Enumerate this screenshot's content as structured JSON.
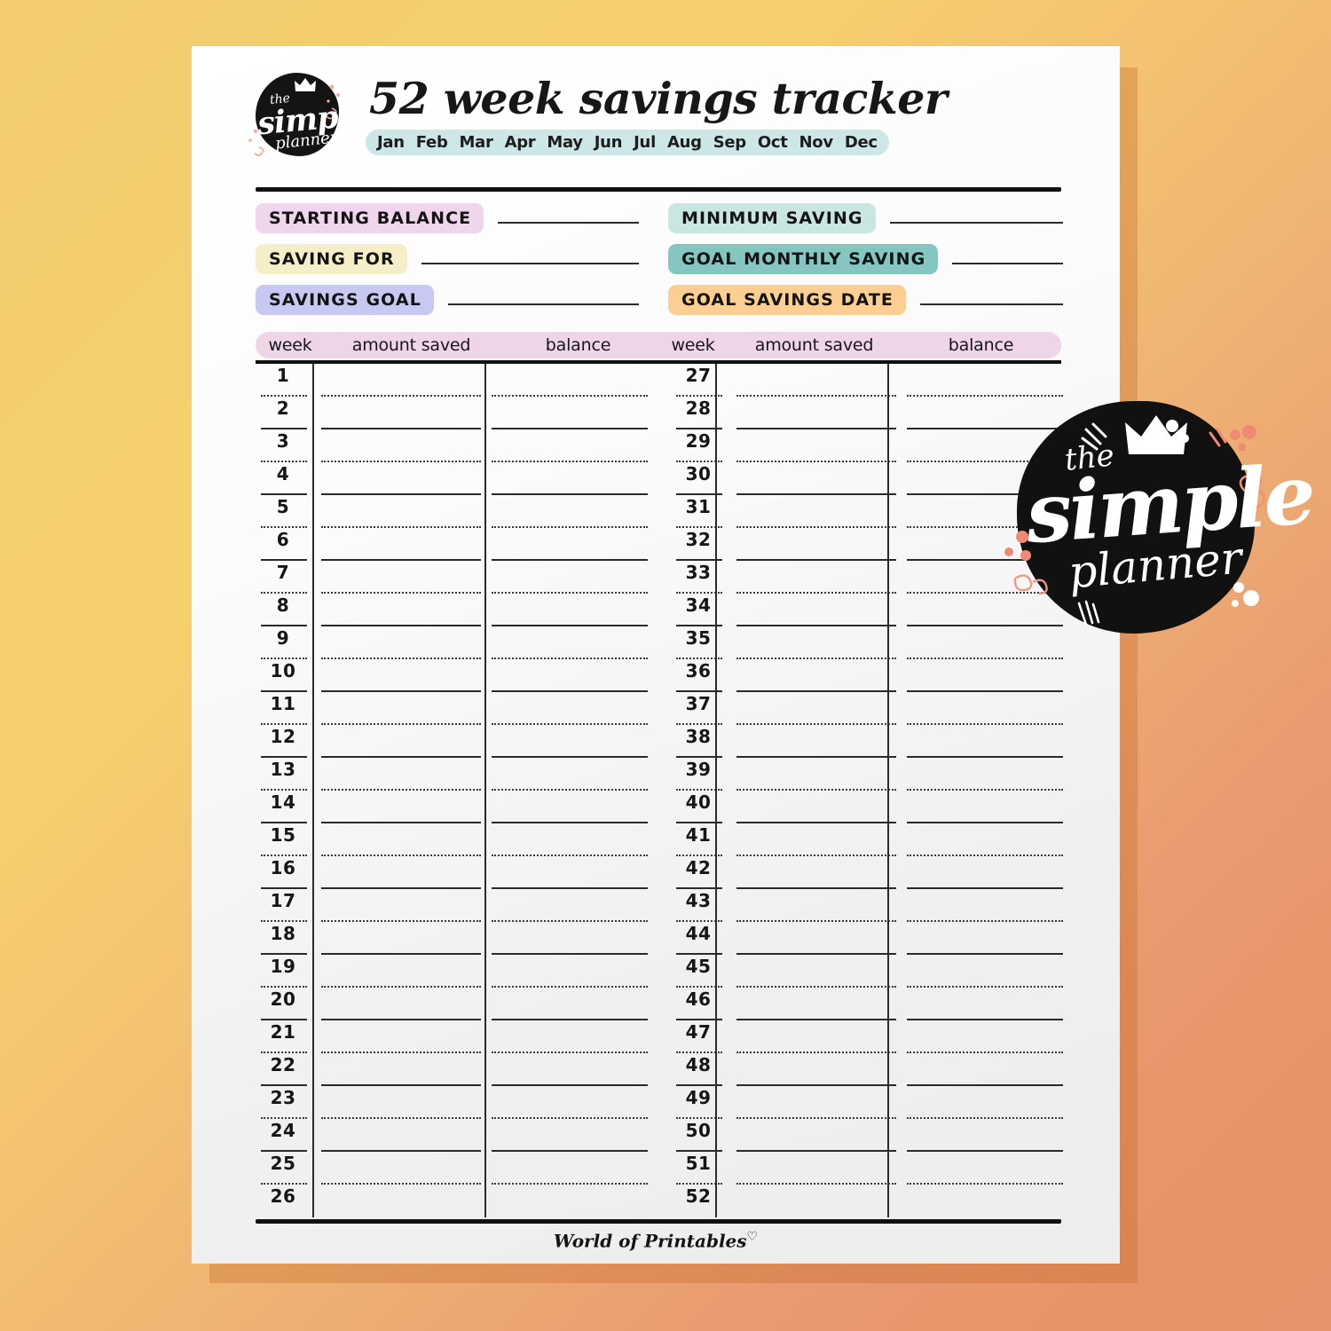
{
  "background": {
    "gradient_from": "#f2cc6e",
    "gradient_to": "#e8946a"
  },
  "header": {
    "logo": {
      "the": "the",
      "simple": "simple",
      "planner": "planner",
      "icon": "crown-icon"
    },
    "title": "52 week savings tracker",
    "months_pill_color": "#cde6e6",
    "months": [
      "Jan",
      "Feb",
      "Mar",
      "Apr",
      "May",
      "Jun",
      "Jul",
      "Aug",
      "Sep",
      "Oct",
      "Nov",
      "Dec"
    ]
  },
  "fields": {
    "left": [
      {
        "label": "STARTING BALANCE",
        "value": "",
        "color": "#f0d6ec"
      },
      {
        "label": "SAVING FOR",
        "value": "",
        "color": "#f6eec9"
      },
      {
        "label": "SAVINGS GOAL",
        "value": "",
        "color": "#c8c9f0"
      }
    ],
    "right": [
      {
        "label": "MINIMUM SAVING",
        "value": "",
        "color": "#c9e6e0"
      },
      {
        "label": "GOAL MONTHLY SAVING",
        "value": "",
        "color": "#86c6c0"
      },
      {
        "label": "GOAL SAVINGS DATE",
        "value": "",
        "color": "#fbcf92"
      }
    ]
  },
  "table": {
    "header_pill_color": "#eed5e8",
    "columns": [
      "week",
      "amount saved",
      "balance",
      "week",
      "amount saved",
      "balance"
    ],
    "left_weeks": [
      1,
      2,
      3,
      4,
      5,
      6,
      7,
      8,
      9,
      10,
      11,
      12,
      13,
      14,
      15,
      16,
      17,
      18,
      19,
      20,
      21,
      22,
      23,
      24,
      25,
      26
    ],
    "right_weeks": [
      27,
      28,
      29,
      30,
      31,
      32,
      33,
      34,
      35,
      36,
      37,
      38,
      39,
      40,
      41,
      42,
      43,
      44,
      45,
      46,
      47,
      48,
      49,
      50,
      51,
      52
    ],
    "left_values": [],
    "right_values": []
  },
  "footer": {
    "text": "World of Printables",
    "heart": "♡"
  },
  "watermark": {
    "the": "the",
    "simple": "simple",
    "planner": "planner",
    "icon": "crown-icon"
  }
}
